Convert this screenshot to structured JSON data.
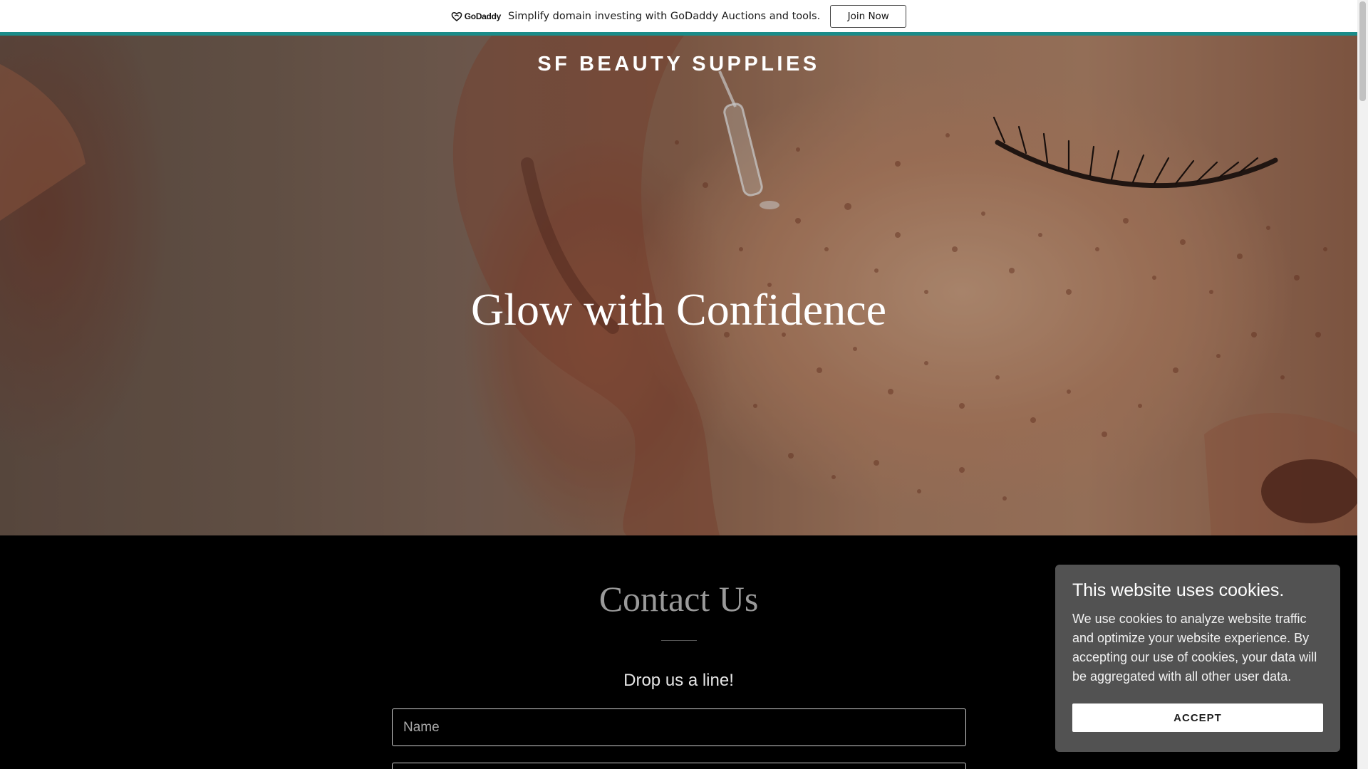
{
  "promo": {
    "logo_text": "GoDaddy",
    "message": "Simplify domain investing with GoDaddy Auctions and tools.",
    "button_label": "Join Now"
  },
  "header": {
    "brand": "SF BEAUTY SUPPLIES"
  },
  "hero": {
    "heading": "Glow with Confidence"
  },
  "contact": {
    "title": "Contact Us",
    "subtitle": "Drop us a line!",
    "name_placeholder": "Name"
  },
  "cookie": {
    "title": "This website uses cookies.",
    "body": "We use cookies to analyze website traffic and optimize your website experience. By accepting our use of cookies, your data will be aggregated with all other user data.",
    "accept_label": "ACCEPT"
  },
  "colors": {
    "accent_rule": "#1a8c89",
    "cookie_bg": "#525252",
    "section_bg": "#000000"
  }
}
